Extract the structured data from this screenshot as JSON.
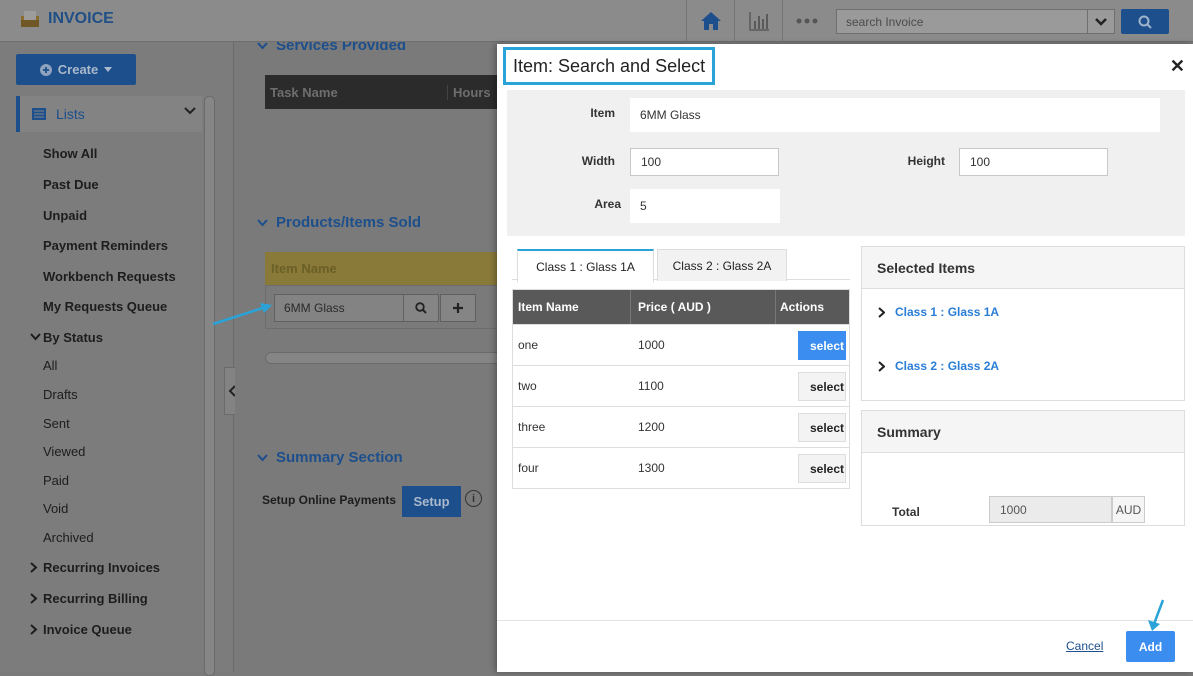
{
  "app": {
    "title": "INVOICE"
  },
  "topbar": {
    "search_placeholder": "search Invoice"
  },
  "sidebar": {
    "create_label": "Create",
    "lists_label": "Lists",
    "items": [
      {
        "label": "Show All",
        "bold": true
      },
      {
        "label": "Past Due",
        "bold": true
      },
      {
        "label": "Unpaid",
        "bold": true
      },
      {
        "label": "Payment Reminders",
        "bold": true
      },
      {
        "label": "Workbench Requests",
        "bold": true
      },
      {
        "label": "My Requests Queue",
        "bold": true
      }
    ],
    "by_status_label": "By Status",
    "status_items": [
      "All",
      "Drafts",
      "Sent",
      "Viewed",
      "Paid",
      "Void",
      "Archived"
    ],
    "groups": [
      "Recurring Invoices",
      "Recurring Billing",
      "Invoice Queue"
    ]
  },
  "main": {
    "services_title": "Services Provided",
    "services_cols": [
      "Task Name",
      "Hours"
    ],
    "products_title": "Products/Items Sold",
    "products_cols": [
      "Item Name"
    ],
    "product_value": "6MM Glass",
    "summary_title": "Summary Section",
    "setup_label": "Setup Online Payments",
    "setup_button": "Setup"
  },
  "modal": {
    "title": "Item: Search and Select",
    "item_label": "Item",
    "item_value": "6MM Glass",
    "width_label": "Width",
    "width_value": "100",
    "height_label": "Height",
    "height_value": "100",
    "area_label": "Area",
    "area_value": "5",
    "tabs": [
      "Class 1 : Glass 1A",
      "Class 2 : Glass 2A"
    ],
    "table_headers": [
      "Item Name",
      "Price ( AUD )",
      "Actions"
    ],
    "rows": [
      {
        "name": "one",
        "price": "1000",
        "action": "select"
      },
      {
        "name": "two",
        "price": "1100",
        "action": "select"
      },
      {
        "name": "three",
        "price": "1200",
        "action": "select"
      },
      {
        "name": "four",
        "price": "1300",
        "action": "select"
      }
    ],
    "selected_title": "Selected Items",
    "selected_items": [
      "Class 1 : Glass 1A",
      "Class 2 : Glass 2A"
    ],
    "summary_title": "Summary",
    "total_label": "Total",
    "total_value": "1000",
    "currency": "AUD",
    "cancel_label": "Cancel",
    "add_label": "Add"
  },
  "colors": {
    "accent": "#3c8df0",
    "highlight": "#29a3d8",
    "brand": "#1d4f8c"
  }
}
